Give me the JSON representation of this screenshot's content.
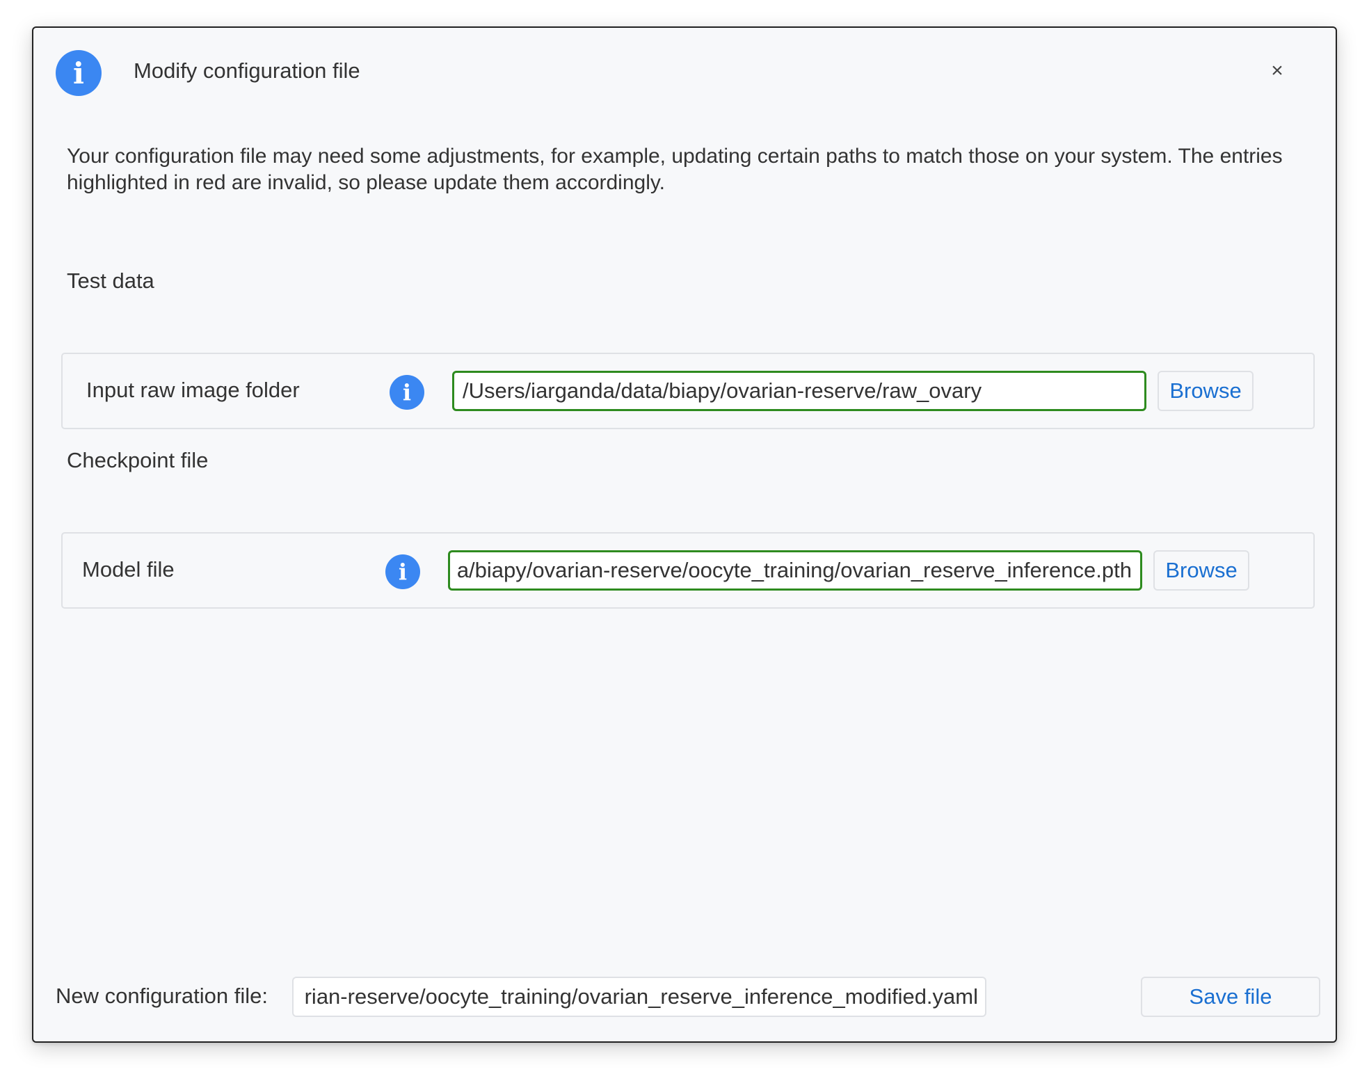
{
  "dialog": {
    "title": "Modify configuration file",
    "header_icon": "info-icon",
    "close_glyph": "×",
    "description": "Your configuration file may need some adjustments, for example, updating certain paths to match those on your system. The entries highlighted in red are invalid, so please update them accordingly."
  },
  "sections": [
    {
      "title": "Test data",
      "field": {
        "label": "Input raw image folder",
        "icon": "info-icon",
        "value": "/Users/iarganda/data/biapy/ovarian-reserve/raw_ovary",
        "browse_label": "Browse"
      }
    },
    {
      "title": "Checkpoint file",
      "field": {
        "label": "Model file",
        "icon": "info-icon",
        "value": "a/biapy/ovarian-reserve/oocyte_training/ovarian_reserve_inference.pth",
        "browse_label": "Browse"
      }
    }
  ],
  "footer": {
    "label": "New configuration file:",
    "value": "rian-reserve/oocyte_training/ovarian_reserve_inference_modified.yaml",
    "save_label": "Save file"
  },
  "colors": {
    "accent": "#3b87f2",
    "valid_border": "#2e8b1f",
    "link_text": "#1a6fd1",
    "background": "#f7f8fa"
  }
}
